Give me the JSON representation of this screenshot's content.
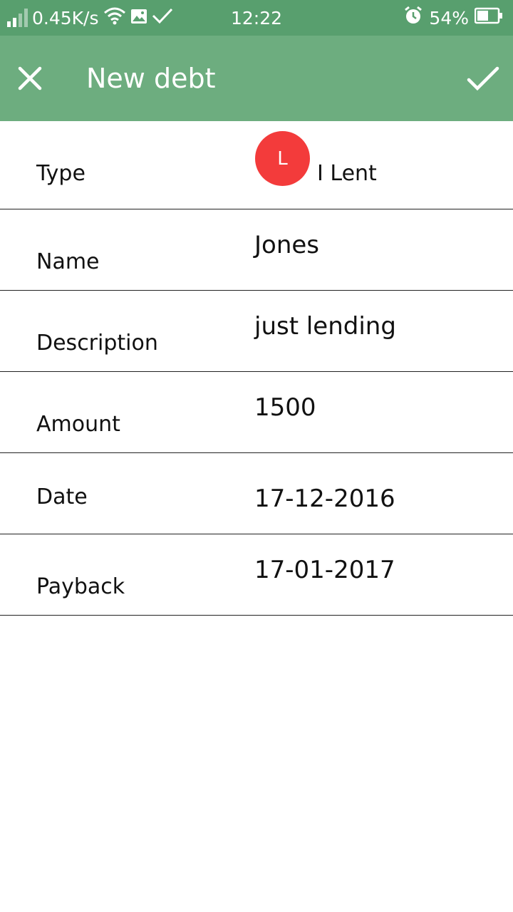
{
  "statusbar": {
    "net_speed": "0.45K/s",
    "time": "12:22",
    "battery": "54%"
  },
  "appbar": {
    "title": "New debt",
    "close_icon": "close-icon",
    "confirm_icon": "check-icon"
  },
  "form": {
    "type": {
      "label": "Type",
      "avatar_letter": "L",
      "value": "I Lent",
      "avatar_color": "#f33b3b"
    },
    "name": {
      "label": "Name",
      "value": "Jones"
    },
    "description": {
      "label": "Description",
      "value": "just lending"
    },
    "amount": {
      "label": "Amount",
      "value": "1500"
    },
    "date": {
      "label": "Date",
      "value": "17-12-2016"
    },
    "payback": {
      "label": "Payback",
      "value": "17-01-2017"
    }
  },
  "colors": {
    "statusbar": "#589f6e",
    "appbar": "#6dad7f"
  }
}
